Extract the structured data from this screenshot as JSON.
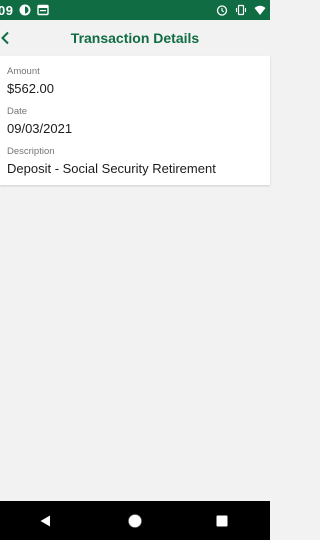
{
  "status_bar": {
    "time": "09",
    "background": "#106c43",
    "left_icons": [
      "app-notification-icon",
      "calendar-notification-icon"
    ],
    "right_icons": [
      "alarm-icon",
      "vibrate-icon",
      "wifi-icon"
    ]
  },
  "header": {
    "title": "Transaction Details",
    "back_icon": "chevron-left-icon",
    "accent_color": "#106c43"
  },
  "details": {
    "amount_label": "Amount",
    "amount_value": "$562.00",
    "date_label": "Date",
    "date_value": "09/03/2021",
    "description_label": "Description",
    "description_value": "Deposit - Social Security Retirement"
  },
  "nav_bar": {
    "buttons": [
      "back-triangle-icon",
      "home-circle-icon",
      "recents-square-icon"
    ]
  }
}
